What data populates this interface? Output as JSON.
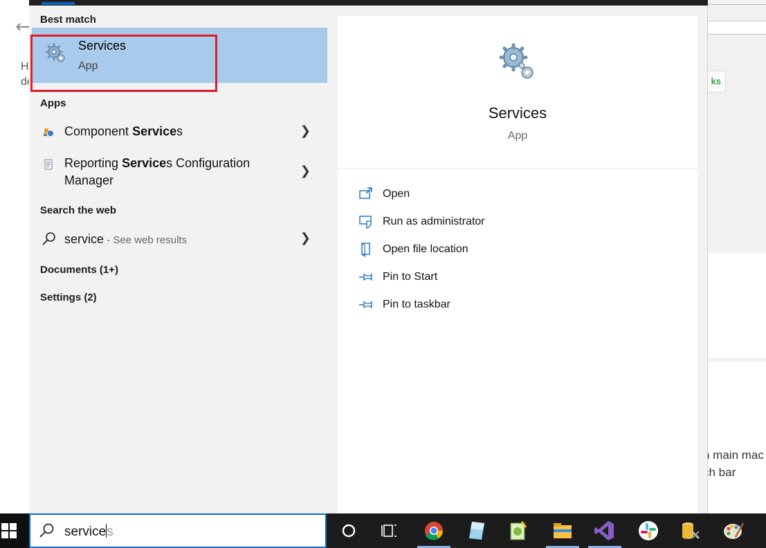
{
  "background": {
    "back_glyph": "←",
    "stub_text": "H de",
    "right_button": "ks",
    "right_text_1": "n main mac",
    "right_text_2": "ch bar"
  },
  "results": {
    "best_match_heading": "Best match",
    "best_match": {
      "title_prefix": "Service",
      "title_suffix": "s",
      "subtitle": "App",
      "icon": "gears-icon"
    },
    "apps_heading": "Apps",
    "apps": [
      {
        "label_pre": "Component ",
        "label_bold": "Service",
        "label_post": "s",
        "icon": "component-services-icon"
      },
      {
        "label_pre": "Reporting ",
        "label_bold": "Service",
        "label_post": "s Configuration",
        "label_line2": "Manager",
        "icon": "report-config-icon"
      }
    ],
    "web_heading": "Search the web",
    "web_item": {
      "query": "service",
      "suffix": " - See web results",
      "icon": "search-icon"
    },
    "documents_heading": "Documents (1+)",
    "settings_heading": "Settings (2)"
  },
  "preview": {
    "title": "Services",
    "subtitle": "App",
    "actions": [
      {
        "label": "Open",
        "icon": "open-icon"
      },
      {
        "label": "Run as administrator",
        "icon": "shield-icon"
      },
      {
        "label": "Open file location",
        "icon": "file-location-icon"
      },
      {
        "label": "Pin to Start",
        "icon": "pin-icon"
      },
      {
        "label": "Pin to taskbar",
        "icon": "pin-icon"
      }
    ]
  },
  "taskbar": {
    "search_typed": "service",
    "search_ghost": "s",
    "icons": [
      "cortana-icon",
      "task-view-icon",
      "chrome-icon",
      "azure-data-studio-icon",
      "notepad-plus-icon",
      "file-explorer-icon",
      "visual-studio-icon",
      "slack-icon",
      "sql-tool-icon",
      "paint-icon"
    ]
  },
  "colors": {
    "highlight": "#a9cbeb",
    "red_box": "#e21a2a",
    "accent_blue": "#0a6ccf",
    "taskbar": "#1c1c1c"
  }
}
